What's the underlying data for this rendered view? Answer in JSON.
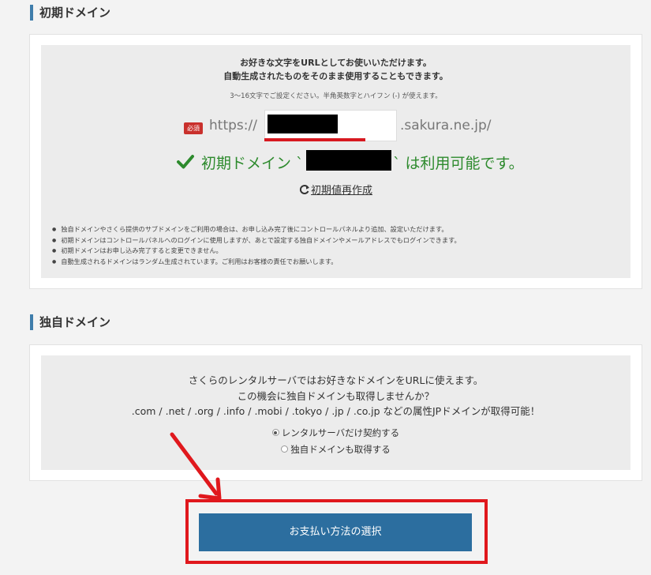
{
  "initial_domain": {
    "heading": "初期ドメイン",
    "intro_line1": "お好きな文字をURLとしてお使いいただけます。",
    "intro_line2": "自動生成されたものをそのまま使用することもできます。",
    "hint": "3〜16文字でご設定ください。半角英数字とハイフン (-) が使えます。",
    "required_badge": "必須",
    "url_prefix": "https://",
    "url_suffix": ".sakura.ne.jp/",
    "availability_prefix": "初期ドメイン `",
    "availability_suffix": "` は利用可能です。",
    "regenerate_label": "初期値再作成",
    "notes": [
      "独自ドメインやさくら提供のサブドメインをご利用の場合は、お申し込み完了後にコントロールパネルより追加、設定いただけます。",
      "初期ドメインはコントロールパネルへのログインに使用しますが、あとで設定する独自ドメインやメールアドレスでもログインできます。",
      "初期ドメインはお申し込み完了すると変更できません。",
      "自動生成されるドメインはランダム生成されています。ご利用はお客様の責任でお願いします。"
    ]
  },
  "custom_domain": {
    "heading": "独自ドメイン",
    "line1": "さくらのレンタルサーバではお好きなドメインをURLに使えます。",
    "line2": "この機会に独自ドメインも取得しませんか？",
    "line3": ".com / .net / .org / .info / .mobi / .tokyo / .jp / .co.jp などの属性JPドメインが取得可能！",
    "options": [
      {
        "label": "レンタルサーバだけ契約する",
        "selected": true
      },
      {
        "label": "独自ドメインも取得する",
        "selected": false
      }
    ]
  },
  "payment_button_label": "お支払い方法の選択",
  "colors": {
    "accent_blue": "#2c6e9f",
    "success_green": "#2d8a2d",
    "annotation_red": "#e0181d",
    "required_red": "#c9302c"
  }
}
